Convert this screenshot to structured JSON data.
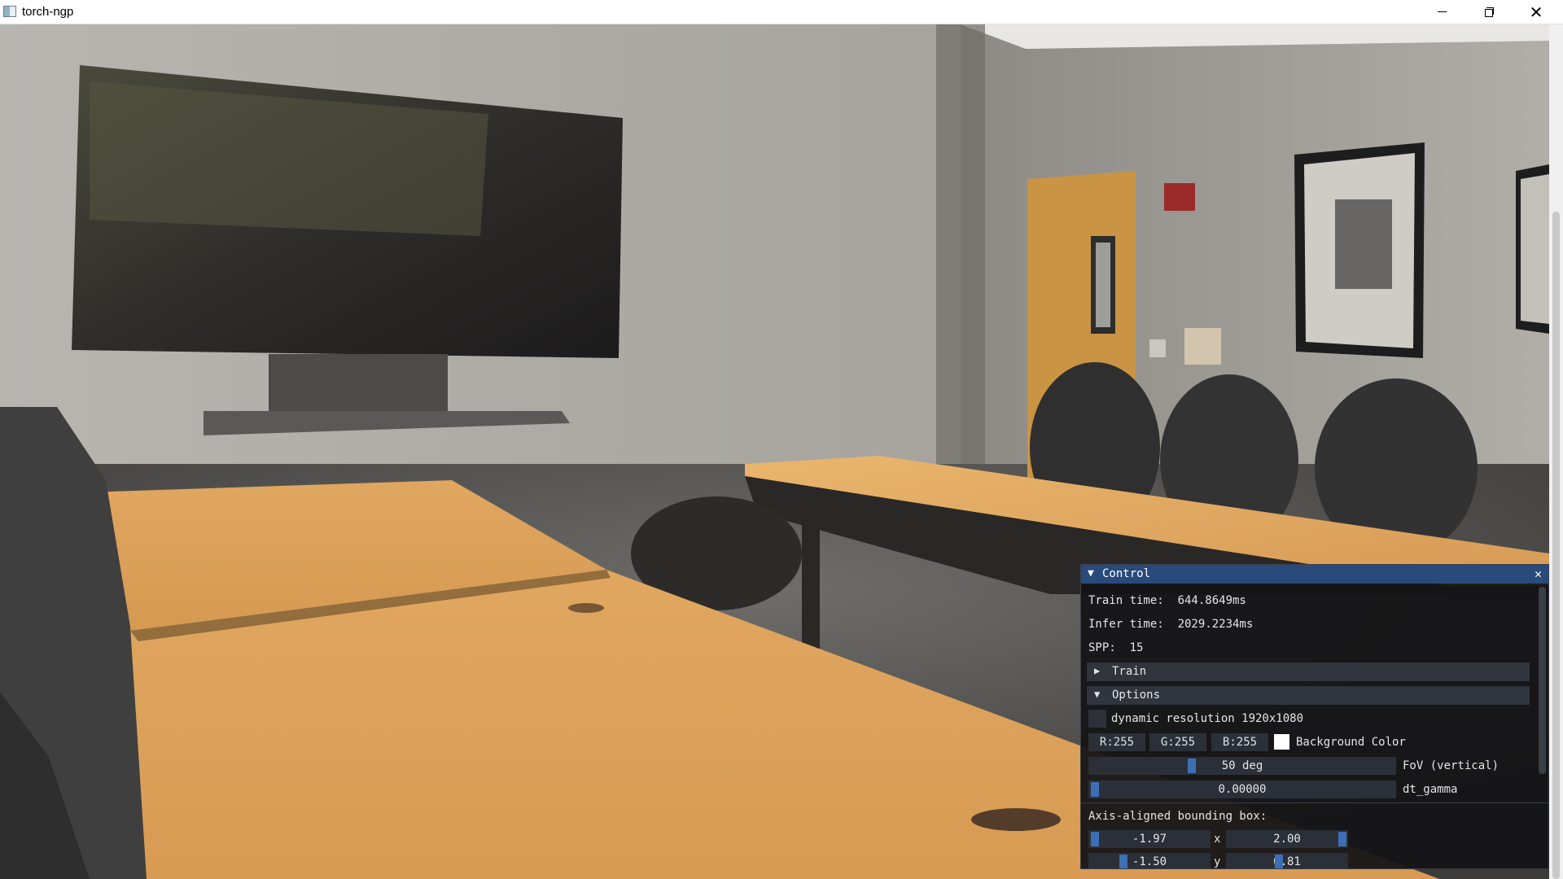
{
  "window": {
    "title": "torch-ngp",
    "icon": "app-icon",
    "controls": [
      "minimize-icon",
      "maximize-icon",
      "close-icon"
    ]
  },
  "viewport": {
    "content": "nerf-render-conference-room"
  },
  "panel": {
    "title": "Control",
    "close_glyph": "✕",
    "stats": {
      "train_time_label": "Train time:",
      "train_time_value": "644.8649ms",
      "infer_time_label": "Infer time:",
      "infer_time_value": "2029.2234ms",
      "spp_label": "SPP:",
      "spp_value": "15"
    },
    "sections": {
      "train": "Train",
      "options": "Options"
    },
    "options": {
      "dynamic_resolution": "dynamic resolution 1920x1080",
      "dynamic_resolution_checked": false,
      "bg_r": "R:255",
      "bg_g": "G:255",
      "bg_b": "B:255",
      "bg_color_hex": "#ffffff",
      "bg_label": "Background Color",
      "fov_value": "50 deg",
      "fov_fraction": 0.33,
      "fov_label": "FoV (vertical)",
      "dt_gamma_value": "0.00000",
      "dt_gamma_fraction": 0.0,
      "dt_gamma_label": "dt_gamma"
    },
    "aabb": {
      "label": "Axis-aligned bounding box:",
      "x_min": "-1.97",
      "x_label": "x",
      "x_max": "2.00",
      "y_min": "-1.50",
      "y_label": "y",
      "y_max": "0.81"
    }
  },
  "colors": {
    "accent": "#294a7a",
    "slider_grab": "#3d6fb5",
    "panel_bg": "#141416"
  }
}
